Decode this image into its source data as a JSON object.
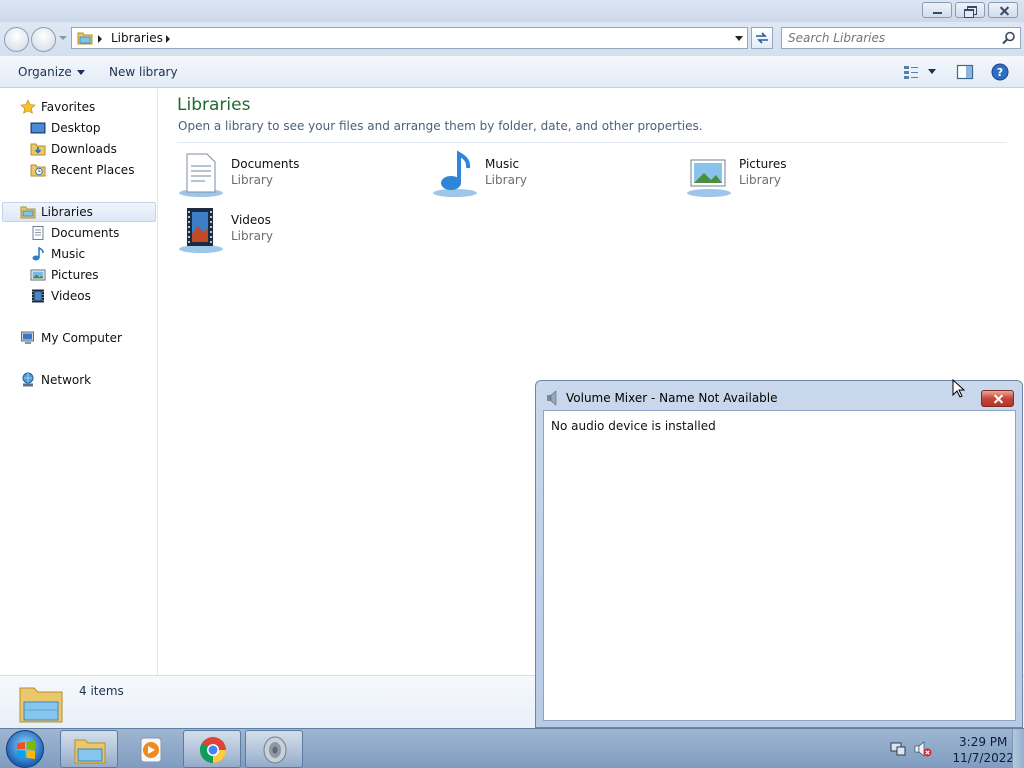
{
  "explorer": {
    "address": {
      "crumb": "Libraries"
    },
    "search": {
      "placeholder": "Search Libraries"
    },
    "command_bar": {
      "organize": "Organize",
      "new_library": "New library"
    },
    "nav": {
      "favorites": "Favorites",
      "favorites_items": [
        "Desktop",
        "Downloads",
        "Recent Places"
      ],
      "libraries": "Libraries",
      "libraries_items": [
        "Documents",
        "Music",
        "Pictures",
        "Videos"
      ],
      "computer": "My Computer",
      "network": "Network"
    },
    "content": {
      "title": "Libraries",
      "subtitle": "Open a library to see your files and arrange them by folder, date, and other properties.",
      "tiles": [
        {
          "name": "Documents",
          "type": "Library",
          "icon": "documents-library-icon"
        },
        {
          "name": "Music",
          "type": "Library",
          "icon": "music-library-icon"
        },
        {
          "name": "Pictures",
          "type": "Library",
          "icon": "pictures-library-icon"
        },
        {
          "name": "Videos",
          "type": "Library",
          "icon": "videos-library-icon"
        }
      ]
    },
    "details": {
      "count": "4 items"
    }
  },
  "mixer": {
    "title": "Volume Mixer - Name Not Available",
    "message": "No audio device is installed"
  },
  "taskbar": {
    "pinned": [
      "file-explorer-icon",
      "media-player-icon",
      "chrome-icon",
      "speaker-icon"
    ],
    "clock": {
      "time": "3:29 PM",
      "date": "11/7/2022"
    }
  },
  "colors": {
    "title_green": "#1e6b2f",
    "accent_blue": "#1d63b8",
    "close_red": "#c7463a"
  }
}
